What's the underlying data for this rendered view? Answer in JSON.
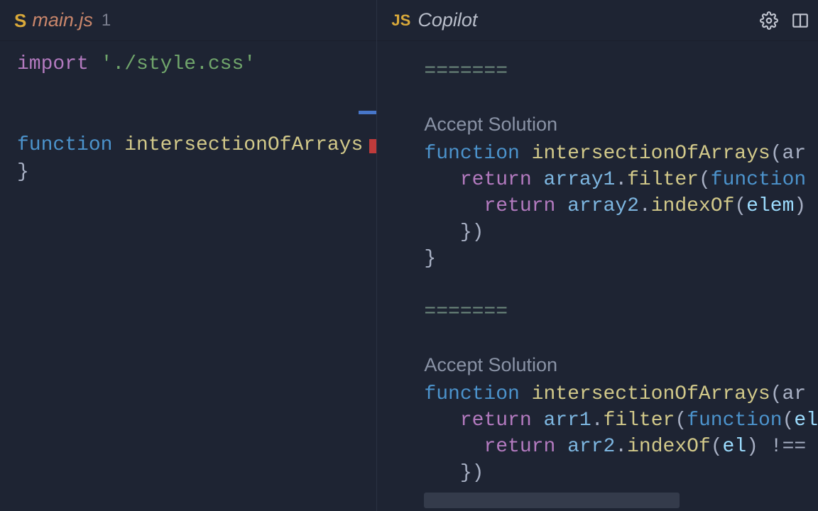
{
  "left_tab": {
    "icon_label": "S",
    "filename": "main.js",
    "badge": "1"
  },
  "right_tab": {
    "icon_label": "JS",
    "title": "Copilot"
  },
  "editor": {
    "line1": {
      "import_kw": "import",
      "string": " './style.css'"
    },
    "line_fn": {
      "function_kw": "function",
      "space": " ",
      "name": "intersectionOfArrays"
    },
    "line_brace": "}"
  },
  "copilot": {
    "separator": "=======",
    "accept_label": "Accept Solution",
    "solutions": [
      {
        "l1": {
          "kw": "function",
          "sp": " ",
          "name": "intersectionOfArrays",
          "tail": "(ar"
        },
        "l2": {
          "ind": "   ",
          "kw": "return",
          "sp": " ",
          "obj": "array1",
          "dot": ".",
          "m": "filter",
          "open": "(",
          "kw2": "function",
          "tail": " "
        },
        "l3": {
          "ind": "     ",
          "kw": "return",
          "sp": " ",
          "obj": "array2",
          "dot": ".",
          "m": "indexOf",
          "open": "(",
          "arg": "elem",
          "close": ") "
        },
        "l4": {
          "ind": "   ",
          "txt": "})"
        },
        "l5": {
          "txt": "}"
        }
      },
      {
        "l1": {
          "kw": "function",
          "sp": " ",
          "name": "intersectionOfArrays",
          "tail": "(ar"
        },
        "l2": {
          "ind": "   ",
          "kw": "return",
          "sp": " ",
          "obj": "arr1",
          "dot": ".",
          "m": "filter",
          "open": "(",
          "kw2": "function",
          "open2": "(",
          "arg": "el",
          "tail": ""
        },
        "l3": {
          "ind": "     ",
          "kw": "return",
          "sp": " ",
          "obj": "arr2",
          "dot": ".",
          "m": "indexOf",
          "open": "(",
          "arg": "el",
          "close": ") !== "
        },
        "l4": {
          "ind": "   ",
          "txt": "})"
        }
      }
    ]
  }
}
